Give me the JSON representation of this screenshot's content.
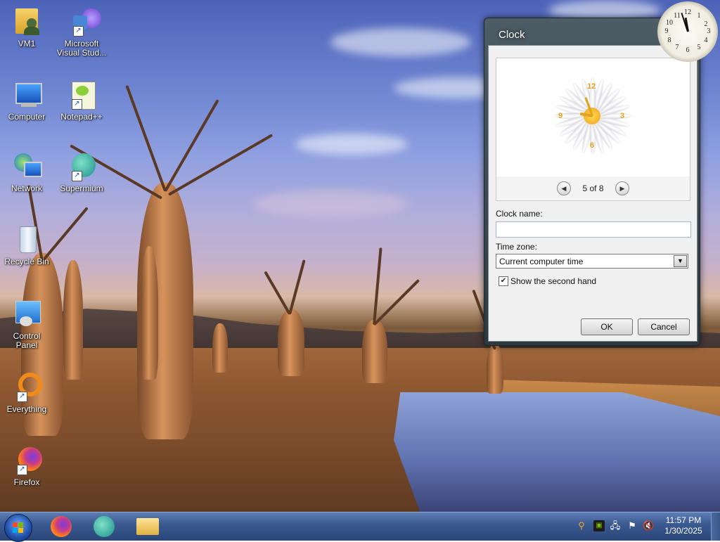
{
  "desktop_icons": [
    {
      "label": "VM1",
      "icon": "user-folder-icon"
    },
    {
      "label": "Microsoft Visual Stud...",
      "icon": "visual-studio-icon"
    },
    {
      "label": "Computer",
      "icon": "computer-icon"
    },
    {
      "label": "Notepad++",
      "icon": "notepadpp-icon"
    },
    {
      "label": "Network",
      "icon": "network-icon"
    },
    {
      "label": "Supermium",
      "icon": "supermium-icon"
    },
    {
      "label": "Recycle Bin",
      "icon": "recycle-bin-icon"
    },
    {
      "label": "Control Panel",
      "icon": "control-panel-icon"
    },
    {
      "label": "Everything",
      "icon": "everything-icon"
    },
    {
      "label": "Firefox",
      "icon": "firefox-icon"
    }
  ],
  "clock_gadget": {
    "numbers": [
      "12",
      "1",
      "2",
      "3",
      "4",
      "5",
      "6",
      "7",
      "8",
      "9",
      "10",
      "11"
    ]
  },
  "dialog": {
    "title": "Clock",
    "preview": {
      "face_numbers": [
        "12",
        "3",
        "6",
        "9"
      ]
    },
    "pager": {
      "label": "5 of 8",
      "prev": "◀",
      "next": "▶"
    },
    "clock_name_label": "Clock name:",
    "clock_name_value": "",
    "time_zone_label": "Time zone:",
    "time_zone_value": "Current computer time",
    "second_hand_label": "Show the second hand",
    "second_hand_checked": true,
    "ok_label": "OK",
    "cancel_label": "Cancel"
  },
  "taskbar": {
    "pinned": [
      "firefox-icon",
      "supermium-icon",
      "file-explorer-icon"
    ],
    "tray": [
      "search-icon",
      "nvidia-icon",
      "network-icon",
      "flag-icon",
      "volume-muted-icon"
    ],
    "time": "11:57 PM",
    "date": "1/30/2025"
  }
}
